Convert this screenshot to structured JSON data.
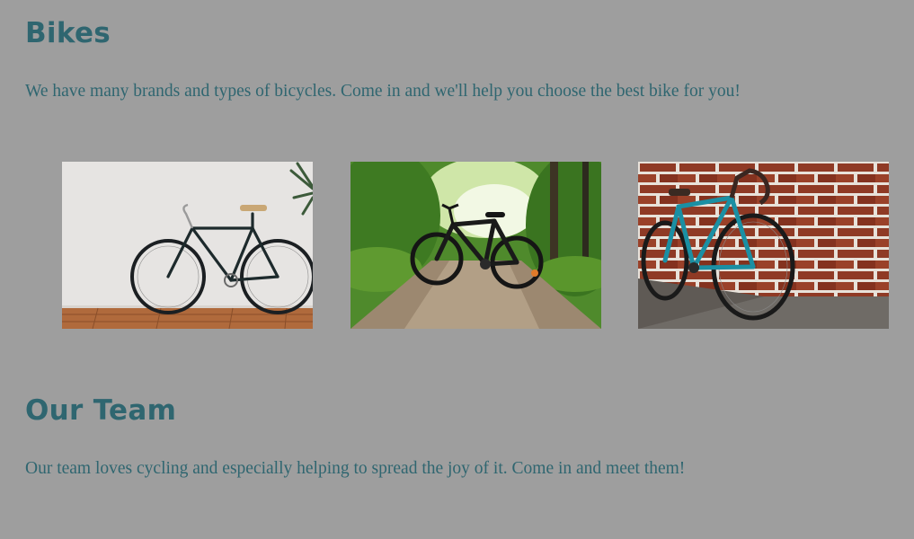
{
  "bikes_section": {
    "heading": "Bikes",
    "description": "We have many brands and types of bicycles. Come in and we'll help you choose the best bike for you!",
    "images": [
      {
        "subject": "black bike against white wall"
      },
      {
        "subject": "black bike on forest path"
      },
      {
        "subject": "teal bike against brick wall"
      }
    ]
  },
  "team_section": {
    "heading": "Our Team",
    "description": "Our team loves cycling and especially helping to spread the joy of it. Come in and meet them!"
  },
  "colors": {
    "background": "#9e9e9e",
    "text": "#2f6670"
  }
}
